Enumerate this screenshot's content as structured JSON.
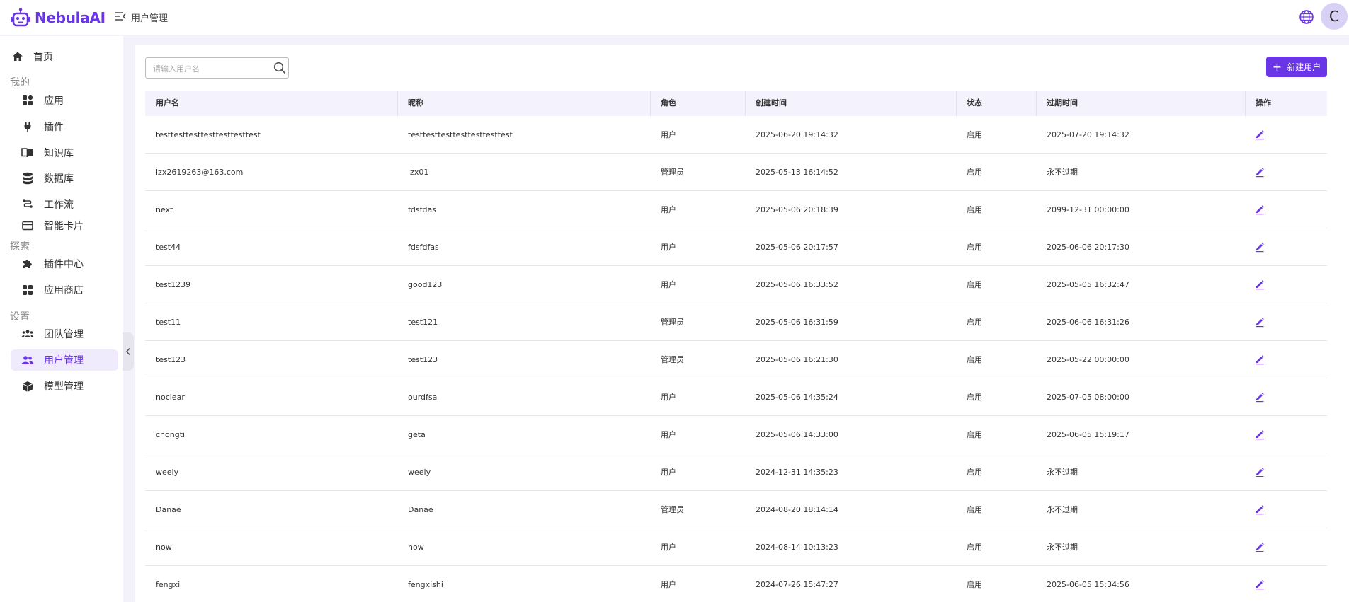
{
  "app": {
    "name": "NebulaAI",
    "brand_color": "#6a35e6"
  },
  "header": {
    "title": "用户管理",
    "avatar_letter": "C"
  },
  "sidebar": {
    "items": [
      {
        "label": "首页",
        "icon": "home-icon"
      },
      {
        "label": "应用",
        "icon": "apps-icon"
      },
      {
        "label": "插件",
        "icon": "plug-icon"
      },
      {
        "label": "知识库",
        "icon": "book-icon"
      },
      {
        "label": "数据库",
        "icon": "database-icon"
      },
      {
        "label": "工作流",
        "icon": "workflow-icon"
      },
      {
        "label": "智能卡片",
        "icon": "card-icon"
      },
      {
        "label": "插件中心",
        "icon": "puzzle-icon"
      },
      {
        "label": "应用商店",
        "icon": "store-icon"
      },
      {
        "label": "团队管理",
        "icon": "team-icon"
      },
      {
        "label": "用户管理",
        "icon": "users-icon"
      },
      {
        "label": "模型管理",
        "icon": "cube-icon"
      }
    ],
    "sections": {
      "mine": "我的",
      "explore": "探索",
      "settings": "设置"
    },
    "active_item": "用户管理"
  },
  "toolbar": {
    "search_placeholder": "请输入用户名",
    "new_user_label": "新建用户"
  },
  "table": {
    "columns": [
      "用户名",
      "昵称",
      "角色",
      "创建时间",
      "状态",
      "过期时间",
      "操作"
    ],
    "rows": [
      {
        "username": "testtesttesttesttesttesttest",
        "nickname": "testtesttesttesttesttesttest",
        "role": "用户",
        "created": "2025-06-20 19:14:32",
        "status": "启用",
        "expires": "2025-07-20 19:14:32"
      },
      {
        "username": "lzx2619263@163.com",
        "nickname": "lzx01",
        "role": "管理员",
        "created": "2025-05-13 16:14:52",
        "status": "启用",
        "expires": "永不过期"
      },
      {
        "username": "next",
        "nickname": "fdsfdas",
        "role": "用户",
        "created": "2025-05-06 20:18:39",
        "status": "启用",
        "expires": "2099-12-31 00:00:00"
      },
      {
        "username": "test44",
        "nickname": "fdsfdfas",
        "role": "用户",
        "created": "2025-05-06 20:17:57",
        "status": "启用",
        "expires": "2025-06-06 20:17:30"
      },
      {
        "username": "test1239",
        "nickname": "good123",
        "role": "用户",
        "created": "2025-05-06 16:33:52",
        "status": "启用",
        "expires": "2025-05-05 16:32:47"
      },
      {
        "username": "test11",
        "nickname": "test121",
        "role": "管理员",
        "created": "2025-05-06 16:31:59",
        "status": "启用",
        "expires": "2025-06-06 16:31:26"
      },
      {
        "username": "test123",
        "nickname": "test123",
        "role": "管理员",
        "created": "2025-05-06 16:21:30",
        "status": "启用",
        "expires": "2025-05-22 00:00:00"
      },
      {
        "username": "noclear",
        "nickname": "ourdfsa",
        "role": "用户",
        "created": "2025-05-06 14:35:24",
        "status": "启用",
        "expires": "2025-07-05 08:00:00"
      },
      {
        "username": "chongti",
        "nickname": "geta",
        "role": "用户",
        "created": "2025-05-06 14:33:00",
        "status": "启用",
        "expires": "2025-06-05 15:19:17"
      },
      {
        "username": "weely",
        "nickname": "weely",
        "role": "用户",
        "created": "2024-12-31 14:35:23",
        "status": "启用",
        "expires": "永不过期"
      },
      {
        "username": "Danae",
        "nickname": "Danae",
        "role": "管理员",
        "created": "2024-08-20 18:14:14",
        "status": "启用",
        "expires": "永不过期"
      },
      {
        "username": "now",
        "nickname": "now",
        "role": "用户",
        "created": "2024-08-14 10:13:23",
        "status": "启用",
        "expires": "永不过期"
      },
      {
        "username": "fengxi",
        "nickname": "fengxishi",
        "role": "用户",
        "created": "2024-07-26 15:47:27",
        "status": "启用",
        "expires": "2025-06-05 15:34:56"
      }
    ]
  }
}
